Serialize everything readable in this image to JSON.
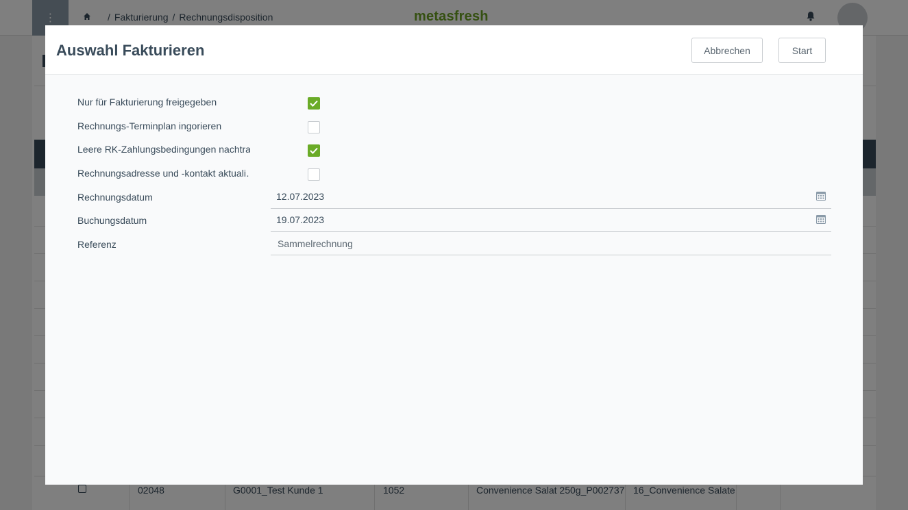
{
  "app": {
    "logo": "metasfresh",
    "breadcrumb": [
      "Fakturierung",
      "Rechnungsdisposition"
    ],
    "menu_icon": "vertical-dots-icon",
    "home_icon": "home-icon",
    "bell_icon": "bell-icon"
  },
  "background_table": {
    "last_row": {
      "doc_no": "02048",
      "customer": "G0001_Test Kunde 1",
      "number": "1052",
      "product": "Convenience Salat 250g_P002737",
      "category": "16_Convenience Salate"
    }
  },
  "modal": {
    "title": "Auswahl Fakturieren",
    "cancel_label": "Abbrechen",
    "start_label": "Start",
    "fields": {
      "only_released": {
        "label": "Nur für Fakturierung freigegeben",
        "checked": true
      },
      "ignore_schedule": {
        "label": "Rechnungs-Terminplan ingorieren",
        "checked": false
      },
      "empty_payment_terms": {
        "label": "Leere RK-Zahlungsbedingungen nachtra…",
        "checked": true
      },
      "update_address": {
        "label": "Rechnungsadresse und -kontakt aktuali…",
        "checked": false
      },
      "invoice_date": {
        "label": "Rechnungsdatum",
        "value": "12.07.2023"
      },
      "posting_date": {
        "label": "Buchungsdatum",
        "value": "19.07.2023"
      },
      "reference": {
        "label": "Referenz",
        "value": "Sammelrechnung"
      }
    }
  },
  "colors": {
    "accent_green": "#6aab27",
    "text_dark": "#394b5a",
    "overlay": "rgba(0,0,0,0.5)"
  }
}
